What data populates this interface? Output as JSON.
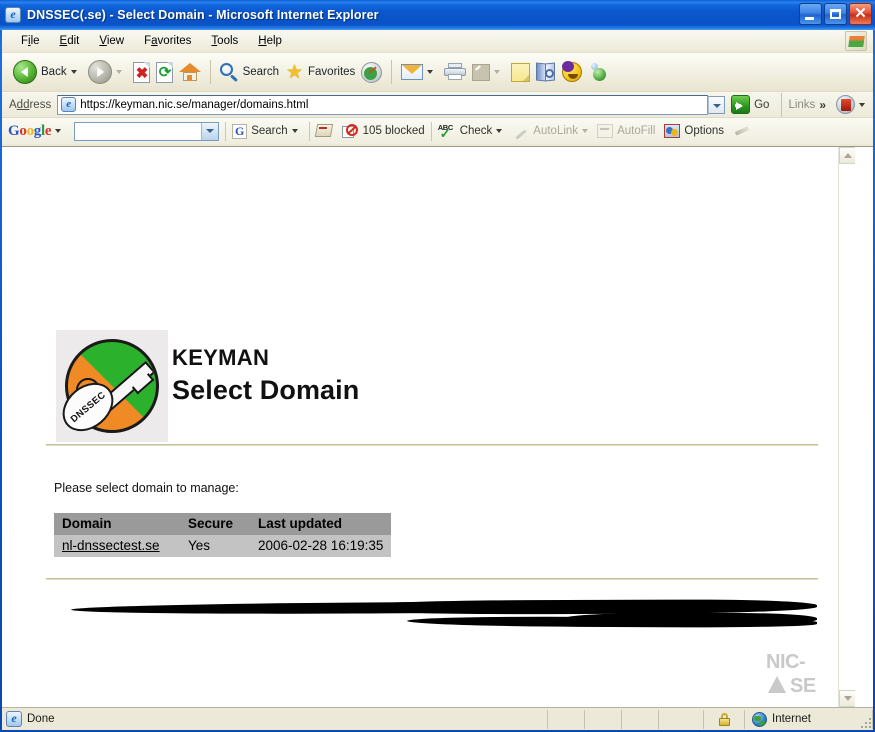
{
  "window": {
    "title": "DNSSEC(.se) - Select Domain - Microsoft Internet Explorer",
    "minimize_label": "Minimize",
    "maximize_label": "Maximize",
    "close_glyph": "✕"
  },
  "menubar": {
    "items": [
      {
        "pre": "F",
        "accel": "i",
        "post": "le",
        "name": "menu-file"
      },
      {
        "pre": "",
        "accel": "E",
        "post": "dit",
        "name": "menu-edit"
      },
      {
        "pre": "",
        "accel": "V",
        "post": "iew",
        "name": "menu-view"
      },
      {
        "pre": "F",
        "accel": "a",
        "post": "vorites",
        "name": "menu-favorites"
      },
      {
        "pre": "",
        "accel": "T",
        "post": "ools",
        "name": "menu-tools"
      },
      {
        "pre": "",
        "accel": "H",
        "post": "elp",
        "name": "menu-help"
      }
    ]
  },
  "toolbar": {
    "back_label": "Back",
    "search_label": "Search",
    "favorites_label": "Favorites"
  },
  "address": {
    "label_pre": "A",
    "label_accel": "dd",
    "label_post": "ress",
    "url": "https://keyman.nic.se/manager/domains.html",
    "go_label": "Go",
    "links_label": "Links",
    "chevron": "»"
  },
  "google_toolbar": {
    "logo": [
      {
        "t": "G",
        "c": "b"
      },
      {
        "t": "o",
        "c": "r"
      },
      {
        "t": "o",
        "c": "y"
      },
      {
        "t": "g",
        "c": "b"
      },
      {
        "t": "l",
        "c": "g"
      },
      {
        "t": "e",
        "c": "r"
      }
    ],
    "search_value": "",
    "search_label": "Search",
    "blocked_label": "105 blocked",
    "check_label": "Check",
    "autolink_label": "AutoLink",
    "autofill_label": "AutoFill",
    "options_label": "Options",
    "g_letter": "G",
    "abc_letters": "ABC",
    "abc_check": "✓"
  },
  "page": {
    "logo_badge_text": "DNSSEC",
    "brand": "KEYMAN",
    "heading": "Select Domain",
    "instruction": "Please select domain to manage:",
    "table": {
      "columns": [
        "Domain",
        "Secure",
        "Last updated"
      ],
      "rows": [
        [
          "nl-dnssectest.se",
          "Yes",
          "2006-02-28 16:19:35"
        ]
      ]
    },
    "footer_logo": {
      "line1": "NIC-",
      "line2": "SE"
    }
  },
  "statusbar": {
    "text": "Done",
    "zone": "Internet"
  }
}
